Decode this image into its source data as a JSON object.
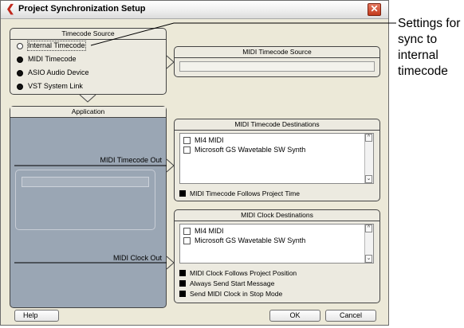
{
  "window": {
    "title": "Project Synchronization Setup",
    "close_glyph": "✕",
    "app_icon": "cubase-logo-icon"
  },
  "timecode_source": {
    "header": "Timecode Source",
    "options": [
      {
        "label": "Internal Timecode",
        "selected": true
      },
      {
        "label": "MIDI Timecode",
        "selected": false
      },
      {
        "label": "ASIO Audio Device",
        "selected": false
      },
      {
        "label": "VST System Link",
        "selected": false
      }
    ]
  },
  "midi_timecode_source": {
    "header": "MIDI Timecode Source",
    "value": ""
  },
  "application": {
    "header": "Application",
    "midi_timecode_out": "MIDI Timecode Out",
    "midi_clock_out": "MIDI Clock Out"
  },
  "mtc_destinations": {
    "header": "MIDI Timecode Destinations",
    "items": [
      "MI4 MIDI",
      "Microsoft GS Wavetable SW Synth"
    ],
    "follow_option": "MIDI Timecode Follows Project Time"
  },
  "clock_destinations": {
    "header": "MIDI Clock Destinations",
    "items": [
      "MI4 MIDI",
      "Microsoft GS Wavetable SW Synth"
    ],
    "options": [
      "MIDI Clock Follows Project Position",
      "Always Send Start Message",
      "Send MIDI Clock in Stop Mode"
    ]
  },
  "buttons": {
    "help": "Help",
    "ok": "OK",
    "cancel": "Cancel"
  },
  "annotation": {
    "text": "Settings for sync to internal timecode"
  }
}
